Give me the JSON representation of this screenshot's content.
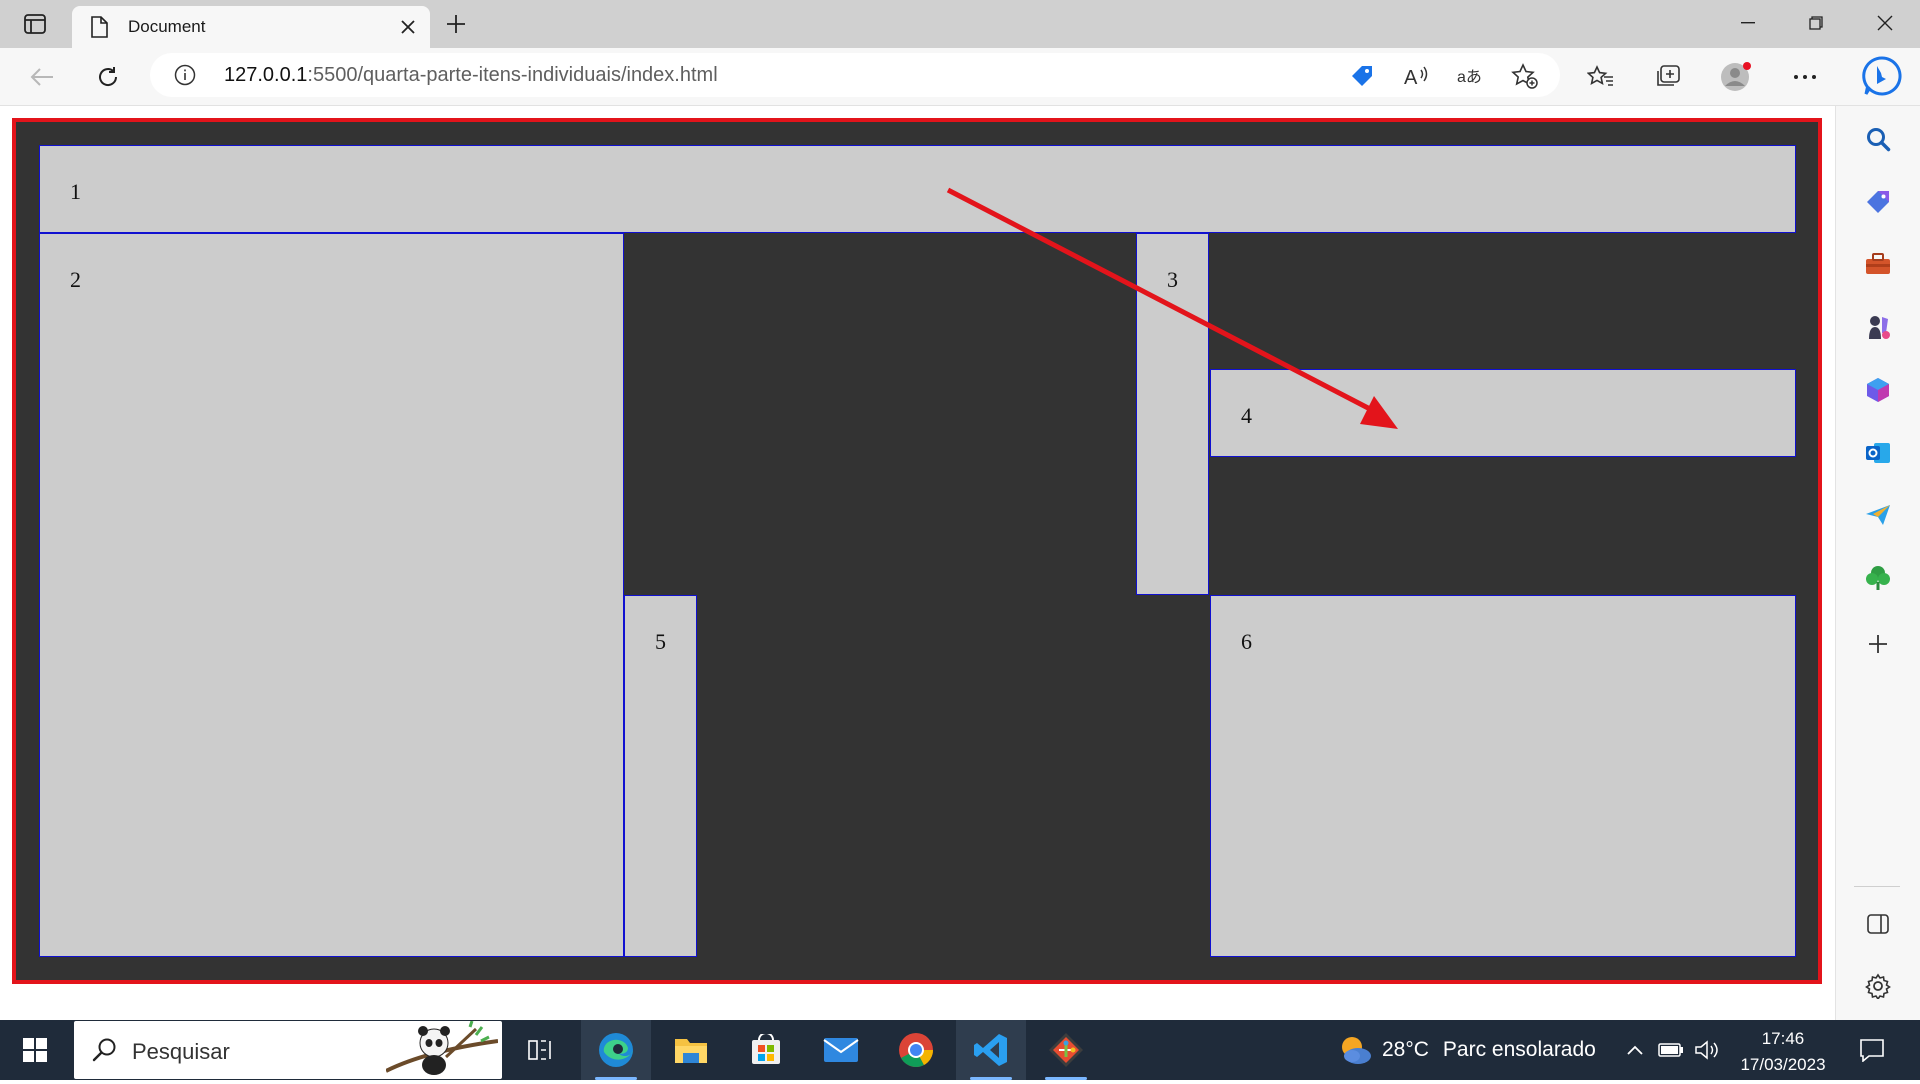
{
  "browser": {
    "tab": {
      "title": "Document"
    },
    "address": {
      "host": "127.0.0.1",
      "path": ":5500/quarta-parte-itens-individuais/index.html"
    }
  },
  "page": {
    "items": [
      {
        "id": "1",
        "label": "1"
      },
      {
        "id": "2",
        "label": "2"
      },
      {
        "id": "3",
        "label": "3"
      },
      {
        "id": "4",
        "label": "4"
      },
      {
        "id": "5",
        "label": "5"
      },
      {
        "id": "6",
        "label": "6"
      }
    ],
    "colors": {
      "container_bg": "#333333",
      "container_border": "#e3141b",
      "item_bg": "#cccccc",
      "item_border": "#1010d0",
      "annotation_arrow": "#e3141b"
    }
  },
  "sidebar": {
    "icons": [
      "search-icon",
      "shopping-tag-icon",
      "tools-icon",
      "games-icon",
      "office-icon",
      "outlook-icon",
      "send-icon",
      "tree-icon",
      "add-icon",
      "split-screen-icon",
      "settings-icon"
    ]
  },
  "taskbar": {
    "search_placeholder": "Pesquisar",
    "weather": {
      "temp": "28°C",
      "condition": "Parc ensolarado"
    },
    "clock": {
      "time": "17:46",
      "date": "17/03/2023"
    },
    "apps": [
      "task-view-icon",
      "edge-icon",
      "file-explorer-icon",
      "store-icon",
      "mail-icon",
      "chrome-icon",
      "vscode-icon",
      "git-icon"
    ]
  }
}
